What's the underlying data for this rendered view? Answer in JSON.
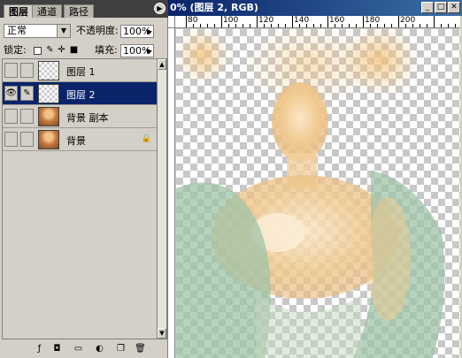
{
  "layers_panel": {
    "tabs": [
      {
        "label": "图层",
        "active": true
      },
      {
        "label": "通道",
        "active": false
      },
      {
        "label": "路径",
        "active": false
      }
    ],
    "blend_mode": "正常",
    "opacity_label": "不透明度:",
    "opacity_value": "100%",
    "lock_label": "锁定:",
    "fill_label": "填充:",
    "fill_value": "100%",
    "layers": [
      {
        "name": "图层 1",
        "visible": false,
        "selected": false
      },
      {
        "name": "图层 2",
        "visible": true,
        "selected": true
      },
      {
        "name": "背景 副本",
        "visible": false,
        "selected": false
      },
      {
        "name": "背景",
        "visible": false,
        "selected": false,
        "locked": true
      }
    ]
  },
  "document": {
    "title": "0% (图层 2, RGB)",
    "ruler_labels": [
      "80",
      "100",
      "120",
      "140",
      "160",
      "180",
      "200"
    ]
  },
  "colors": {
    "selection": "#0a246a",
    "panel_bg": "#d4d0c8",
    "title_bar": "#0a246a"
  }
}
